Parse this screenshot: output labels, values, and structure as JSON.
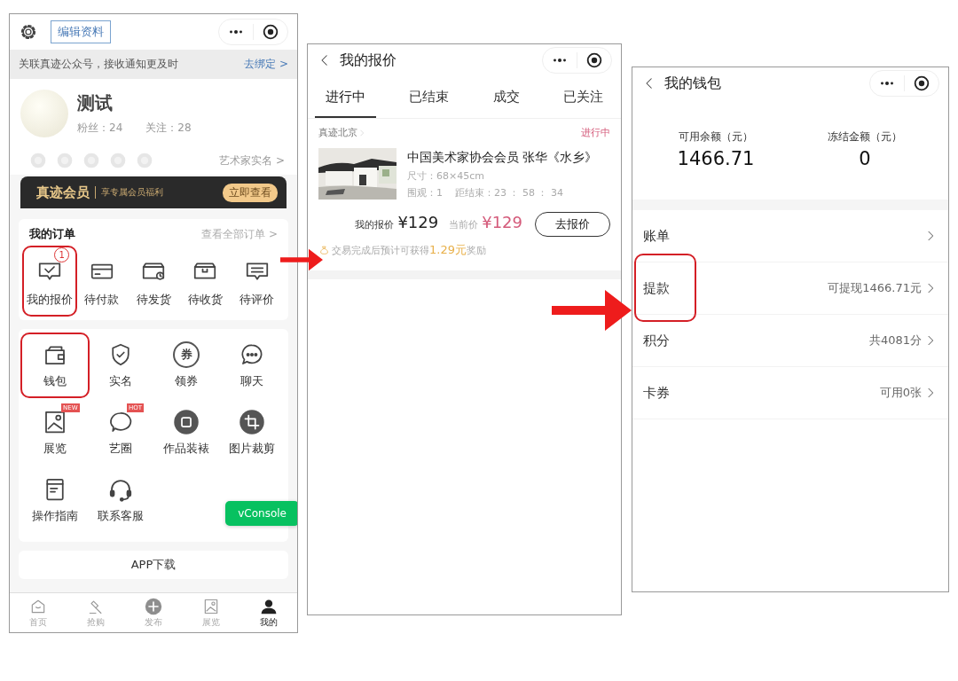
{
  "profile_screen": {
    "edit_button": "编辑资料",
    "notice": {
      "text": "关联真迹公众号，接收通知更及时",
      "link": "去绑定 >"
    },
    "user": {
      "name": "测试",
      "fans": "粉丝：24",
      "follows": "关注：28"
    },
    "artist_link": "艺术家实名 >",
    "member_banner": {
      "title": "真迹会员",
      "subtitle": "享专属会员福利",
      "button": "立即查看"
    },
    "orders": {
      "title": "我的订单",
      "link": "查看全部订单 >",
      "items": [
        {
          "label": "我的报价",
          "badge": "1",
          "highlighted": true
        },
        {
          "label": "待付款",
          "highlighted": false
        },
        {
          "label": "待发货",
          "highlighted": false
        },
        {
          "label": "待收货",
          "highlighted": false
        },
        {
          "label": "待评价",
          "highlighted": false
        }
      ]
    },
    "tools": [
      {
        "label": "钱包",
        "highlighted": true
      },
      {
        "label": "实名",
        "highlighted": false
      },
      {
        "label": "领券",
        "icon_text": "券",
        "highlighted": false
      },
      {
        "label": "聊天",
        "highlighted": false
      },
      {
        "label": "展览",
        "tag": "NEW",
        "highlighted": false
      },
      {
        "label": "艺圈",
        "tag": "HOT",
        "highlighted": false
      },
      {
        "label": "作品装裱",
        "highlighted": false
      },
      {
        "label": "图片裁剪",
        "highlighted": false
      },
      {
        "label": "操作指南",
        "highlighted": false
      },
      {
        "label": "联系客服",
        "highlighted": false
      }
    ],
    "vconsole": "vConsole",
    "app_download": "APP下载",
    "tab_bar": [
      {
        "label": "首页",
        "selected": false
      },
      {
        "label": "抢购",
        "selected": false
      },
      {
        "label": "发布",
        "selected": false
      },
      {
        "label": "展览",
        "selected": false
      },
      {
        "label": "我的",
        "selected": true
      }
    ]
  },
  "bids_screen": {
    "title": "我的报价",
    "tabs": [
      {
        "label": "进行中",
        "selected": true
      },
      {
        "label": "已结束",
        "selected": false
      },
      {
        "label": "成交",
        "selected": false
      },
      {
        "label": "已关注",
        "selected": false
      }
    ],
    "card": {
      "shop": "真迹北京",
      "status": "进行中",
      "title": "中国美术家协会会员 张华《水乡》",
      "size": "尺寸：68×45cm",
      "views": "围观：1",
      "countdown": "距结束：23 ： 58 ： 34",
      "my_bid_label": "我的报价",
      "my_bid": "¥129",
      "current_label": "当前价",
      "current": "¥129",
      "button": "去报价",
      "reward": "交易完成后预计可获得**1.29元**奖励"
    }
  },
  "wallet_screen": {
    "title": "我的钱包",
    "balances": [
      {
        "label": "可用余额（元）",
        "amount": "1466.71"
      },
      {
        "label": "冻结金额（元）",
        "amount": "0"
      }
    ],
    "rows": [
      {
        "label": "账单",
        "highlighted": false
      },
      {
        "label": "提款",
        "value": "可提现1466.71元",
        "highlighted": true
      },
      {
        "label": "积分",
        "value": "共4081分",
        "highlighted": false
      },
      {
        "label": "卡券",
        "value": "可用0张",
        "highlighted": false
      }
    ]
  }
}
